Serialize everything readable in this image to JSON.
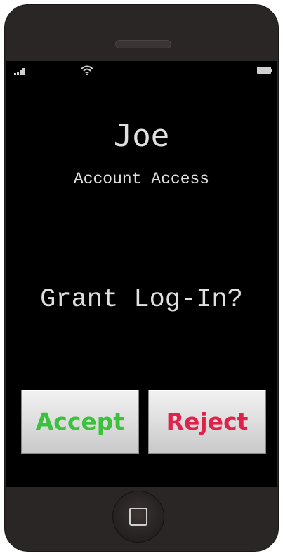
{
  "status_bar": {
    "icons": [
      "signal-icon",
      "wifi-icon",
      "battery-icon"
    ]
  },
  "prompt": {
    "name": "Joe",
    "subtitle": "Account Access",
    "question": "Grant Log-In?"
  },
  "buttons": {
    "accept_label": "Accept",
    "reject_label": "Reject"
  },
  "colors": {
    "screen_background": "#000000",
    "text": "#e0e0e0",
    "accept": "#3cc13c",
    "reject": "#e0224a",
    "phone_body": "#2a2625"
  },
  "hardware": {
    "home_button_icon": "home-square-icon"
  }
}
